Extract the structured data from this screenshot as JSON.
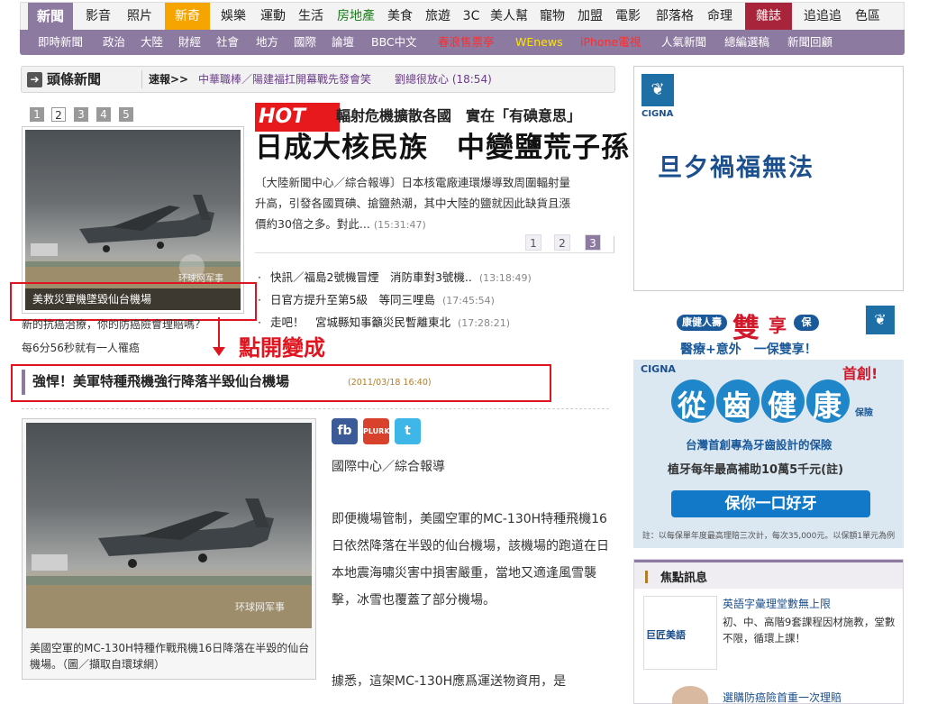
{
  "nav": {
    "main": [
      "新聞",
      "影音",
      "照片",
      "新奇",
      "娛樂",
      "運動",
      "生活",
      "房地產",
      "美食",
      "旅遊",
      "3C",
      "美人幫",
      "寵物",
      "加盟",
      "電影",
      "部落格",
      "命理",
      "雜誌",
      "追追追",
      "色區"
    ],
    "sub": [
      "即時新聞",
      "政治",
      "大陸",
      "財經",
      "社會",
      "地方",
      "國際",
      "論壇",
      "BBC中文",
      "春浪售票亭",
      "WEnews",
      "iPhone電視",
      "人氣新聞",
      "總編選稿",
      "新聞回顧"
    ]
  },
  "headline_bar": {
    "title": "頭條新聞",
    "flash_label": "速報>>",
    "flash_text": "中華職棒／陽建福扛開幕戰先發會笑",
    "flash_text2": "劉總很放心 (18:54)"
  },
  "slideshow": {
    "pages": [
      "1",
      "2",
      "3",
      "4",
      "5"
    ],
    "active_page": 2,
    "photo_caption": "美救災軍機墜毀仙台機場",
    "watermark": "环球网军事"
  },
  "main_story": {
    "hot_label": "HOT",
    "subtitle": "輻射危機擴散各國　實在「有碘意思」",
    "title": "日成大核民族　中變鹽荒子孫",
    "lead_line1": "〔大陸新聞中心／綜合報導〕日本核電廠連環爆導致周圍輻射量",
    "lead_line2": "升高，引發各國買碘、搶鹽熱潮，其中大陸的鹽就因此缺貨且漲",
    "lead_line3": "價約30倍之多。對此...",
    "lead_time": "(15:31:47)",
    "pages": [
      "1",
      "2",
      "3"
    ],
    "active_page": 3
  },
  "news_list": [
    {
      "text": "快訊／福島2號機冒煙　消防車對3號機..",
      "time": "(13:18:49)"
    },
    {
      "text": "日官方提升至第5級　等同三哩島",
      "time": "(17:45:54)"
    },
    {
      "text": "走吧！　宮城縣知事籲災民暫離東北",
      "time": "(17:28:21)"
    }
  ],
  "extra_lines": [
    "新的抗癌治療，你的防癌險會理賠嗎？",
    "每6分56秒就有一人罹癌"
  ],
  "annotation": "點開變成",
  "article": {
    "title": "強悍！美軍特種飛機強行降落半毀仙台機場",
    "date": "(2011/03/18 16:40)",
    "photo_caption": "美國空軍的MC-130H特種作戰飛機16日降落在半毀的仙台機場。（圖／擷取自環球網）",
    "source": "國際中心／綜合報導",
    "paragraph1": "即便機場管制，美國空軍的MC-130H特種飛機16日依然降落在半毀的仙台機場，該機場的跑道在日本地震海嘯災害中損害嚴重，當地又適逢風雪襲擊，冰雪也覆蓋了部分機場。",
    "paragraph2": "據悉，這架MC-130H應爲運送物資用，是",
    "social": [
      "fb",
      "PLURK",
      "t"
    ]
  },
  "ad_top": {
    "brand": "CIGNA",
    "text": "旦夕禍福無法"
  },
  "ad_mid": {
    "brand_top": "康健人壽",
    "double": "雙",
    "enjoy": "享",
    "insure": "保",
    "line": "醫療+意外　一保雙享！",
    "brand": "CIGNA",
    "first": "首創!",
    "slogan": [
      "從",
      "齒",
      "健",
      "康"
    ],
    "small": "保險",
    "desc": "台灣首創專為牙齒設計的保險",
    "subsidy": "植牙每年最高補助10萬5千元(註)",
    "button": "保你一口好牙",
    "footnote": "註：以每保單年度最高理賠三次計，每次35,000元。以保額1單元為例"
  },
  "focus": {
    "title": "焦點訊息",
    "item1_title": "英語字彙理堂數無上限",
    "item1_desc": "初、中、高階9套課程因材施教，堂數不限，循環上課！",
    "item1_brand": "巨匠美語",
    "item2_title": "選購防癌險首重一次理賠"
  },
  "colors": {
    "purple": "#8d7aa0",
    "red": "#e0141e",
    "brand_blue": "#1b4f8d"
  }
}
